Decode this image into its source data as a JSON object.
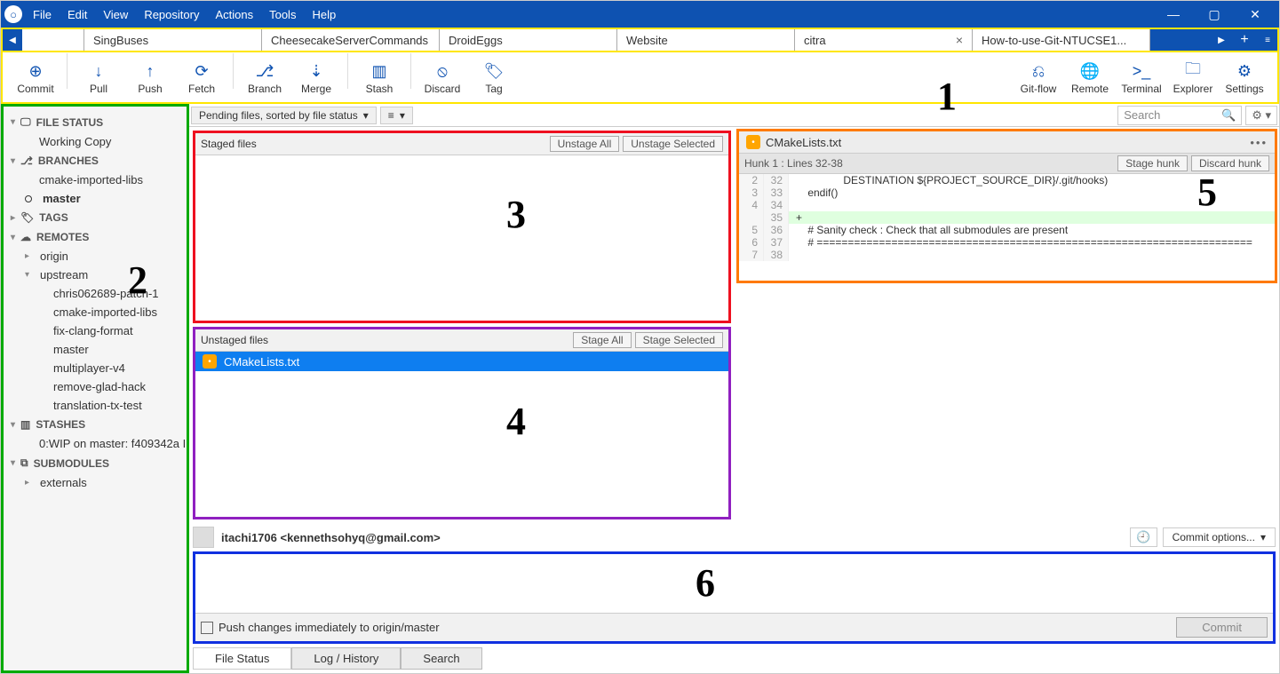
{
  "menubar": [
    "File",
    "Edit",
    "View",
    "Repository",
    "Actions",
    "Tools",
    "Help"
  ],
  "tabs": [
    {
      "label": ""
    },
    {
      "label": "SingBuses"
    },
    {
      "label": "CheesecakeServerCommands"
    },
    {
      "label": "DroidEggs"
    },
    {
      "label": "Website"
    },
    {
      "label": "citra",
      "closable": true
    },
    {
      "label": "How-to-use-Git-NTUCSE1..."
    }
  ],
  "toolbar_left": [
    {
      "name": "commit",
      "label": "Commit",
      "glyph": "⊕"
    },
    {
      "name": "pull",
      "label": "Pull",
      "glyph": "↓"
    },
    {
      "name": "push",
      "label": "Push",
      "glyph": "↑"
    },
    {
      "name": "fetch",
      "label": "Fetch",
      "glyph": "⟳"
    },
    {
      "name": "branch",
      "label": "Branch",
      "glyph": "⎇"
    },
    {
      "name": "merge",
      "label": "Merge",
      "glyph": "⇣"
    },
    {
      "name": "stash",
      "label": "Stash",
      "glyph": "▥"
    },
    {
      "name": "discard",
      "label": "Discard",
      "glyph": "⦸"
    },
    {
      "name": "tag",
      "label": "Tag",
      "glyph": "🏷"
    }
  ],
  "toolbar_right": [
    {
      "name": "gitflow",
      "label": "Git-flow",
      "glyph": "⎌"
    },
    {
      "name": "remote",
      "label": "Remote",
      "glyph": "🌐"
    },
    {
      "name": "terminal",
      "label": "Terminal",
      "glyph": ">_"
    },
    {
      "name": "explorer",
      "label": "Explorer",
      "glyph": "🗀"
    },
    {
      "name": "settings",
      "label": "Settings",
      "glyph": "⚙"
    }
  ],
  "sidebar": {
    "file_status": {
      "header": "FILE STATUS",
      "items": [
        "Working Copy"
      ]
    },
    "branches": {
      "header": "BRANCHES",
      "items": [
        {
          "label": "cmake-imported-libs",
          "current": false
        },
        {
          "label": "master",
          "current": true
        }
      ]
    },
    "tags": {
      "header": "TAGS"
    },
    "remotes": {
      "header": "REMOTES",
      "items": [
        {
          "label": "origin",
          "children": []
        },
        {
          "label": "upstream",
          "children": [
            "chris062689-patch-1",
            "cmake-imported-libs",
            "fix-clang-format",
            "master",
            "multiplayer-v4",
            "remove-glad-hack",
            "translation-tx-test"
          ]
        }
      ]
    },
    "stashes": {
      "header": "STASHES",
      "items": [
        "0:WIP on master: f409342a I"
      ]
    },
    "submodules": {
      "header": "SUBMODULES",
      "items": [
        "externals"
      ]
    }
  },
  "filter": {
    "label": "Pending files, sorted by file status",
    "search_placeholder": "Search"
  },
  "staged": {
    "header": "Staged files",
    "btn1": "Unstage All",
    "btn2": "Unstage Selected"
  },
  "unstaged": {
    "header": "Unstaged files",
    "btn1": "Stage All",
    "btn2": "Stage Selected",
    "files": [
      "CMakeLists.txt"
    ]
  },
  "diff": {
    "filename": "CMakeLists.txt",
    "hunk_label": "Hunk 1 : Lines 32-38",
    "btn1": "Stage hunk",
    "btn2": "Discard hunk",
    "lines": [
      {
        "a": "2",
        "b": "32",
        "t": "                DESTINATION ${PROJECT_SOURCE_DIR}/.git/hooks)",
        "cls": ""
      },
      {
        "a": "3",
        "b": "33",
        "t": "    endif()",
        "cls": ""
      },
      {
        "a": "4",
        "b": "34",
        "t": "",
        "cls": ""
      },
      {
        "a": "",
        "b": "35",
        "t": "+",
        "cls": "line-add"
      },
      {
        "a": "5",
        "b": "36",
        "t": "    # Sanity check : Check that all submodules are present",
        "cls": ""
      },
      {
        "a": "6",
        "b": "37",
        "t": "    # ======================================================================",
        "cls": ""
      },
      {
        "a": "7",
        "b": "38",
        "t": "",
        "cls": ""
      }
    ]
  },
  "commit": {
    "author": "itachi1706 <kennethsohyq@gmail.com>",
    "options_label": "Commit options...",
    "push_label": "Push changes immediately to origin/master",
    "commit_btn": "Commit"
  },
  "bottom_tabs": [
    "File Status",
    "Log / History",
    "Search"
  ],
  "annotations": {
    "a1": "1",
    "a2": "2",
    "a3": "3",
    "a4": "4",
    "a5": "5",
    "a6": "6"
  }
}
